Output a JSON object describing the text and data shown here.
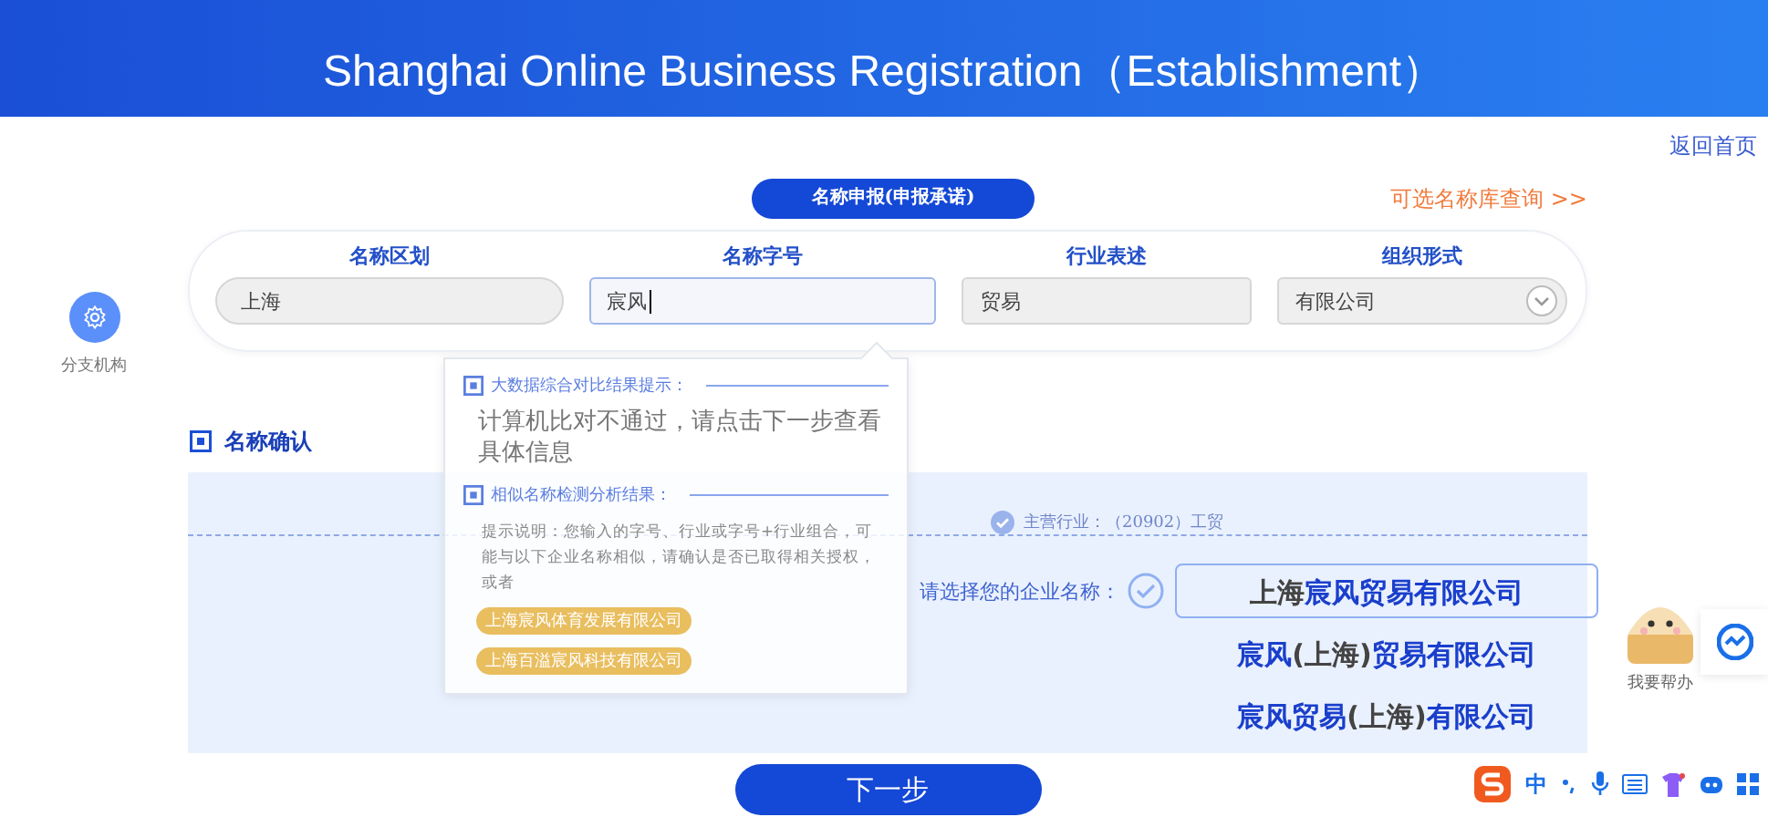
{
  "header": {
    "subtitle": "Shanghai Online Business Registration（Establishment）"
  },
  "back_link": "返回首页",
  "step_tab": "名称申报(申报承诺)",
  "library_link": "可选名称库查询 >>",
  "side_action": {
    "label": "分支机构"
  },
  "fields": [
    {
      "label": "名称区划",
      "value": "上海",
      "kind": "text",
      "focused": false
    },
    {
      "label": "名称字号",
      "value": "宸风",
      "kind": "text",
      "focused": true
    },
    {
      "label": "行业表述",
      "value": "贸易",
      "kind": "text",
      "focused": false
    },
    {
      "label": "组织形式",
      "value": "有限公司",
      "kind": "select",
      "focused": false
    }
  ],
  "section_title": "名称确认",
  "industry": "主营行业：（20902）工贸",
  "choose_label": "请选择您的企业名称：",
  "name_options": [
    {
      "parts": [
        {
          "text": "上海",
          "kind": "region"
        },
        {
          "text": "宸风贸易有限公司",
          "kind": "name"
        }
      ],
      "selected": true
    },
    {
      "parts": [
        {
          "text": "宸风",
          "kind": "name"
        },
        {
          "text": "(上海)",
          "kind": "region"
        },
        {
          "text": "贸易有限公司",
          "kind": "name"
        }
      ],
      "selected": false
    },
    {
      "parts": [
        {
          "text": "宸风贸易",
          "kind": "name"
        },
        {
          "text": "(上海)",
          "kind": "region"
        },
        {
          "text": "有限公司",
          "kind": "name"
        }
      ],
      "selected": false
    }
  ],
  "next_button": "下一步",
  "popup": {
    "sections": [
      {
        "title": "大数据综合对比结果提示：",
        "message": "计算机比对不通过，请点击下一步查看具体信息"
      },
      {
        "title": "相似名称检测分析结果：",
        "note": "提示说明：您输入的字号、行业或字号+行业组合，可能与以下企业名称相似，请确认是否已取得相关授权，或者",
        "similar": [
          "上海宸风体育发展有限公司",
          "上海百溢宸风科技有限公司"
        ]
      }
    ]
  },
  "assistant": {
    "label": "我要帮办"
  },
  "ime_toolbar": {
    "mode": "中"
  }
}
